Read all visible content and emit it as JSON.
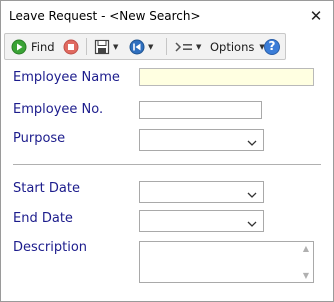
{
  "window": {
    "title": "Leave Request - <New Search>",
    "close_glyph": "✕"
  },
  "toolbar": {
    "find_label": "Find",
    "options_label": "Options",
    "icons": [
      "find-icon",
      "stop-icon",
      "save-icon",
      "navigate-icon",
      "indent-list-icon",
      "help-icon"
    ],
    "help_glyph": "?",
    "dropdown_glyph": "▼"
  },
  "form": {
    "employee_name": {
      "label": "Employee Name",
      "value": ""
    },
    "employee_no": {
      "label": "Employee No.",
      "value": ""
    },
    "purpose": {
      "label": "Purpose",
      "value": ""
    },
    "start_date": {
      "label": "Start Date",
      "value": ""
    },
    "end_date": {
      "label": "End Date",
      "value": ""
    },
    "description": {
      "label": "Description",
      "value": ""
    }
  },
  "colors": {
    "label_text": "#1c1c8c",
    "highlight_field": "#ffffe1",
    "find_green": "#3aa335",
    "stop_red": "#e06a60",
    "nav_blue": "#2f6fbf",
    "help_blue": "#3b7dd8"
  }
}
